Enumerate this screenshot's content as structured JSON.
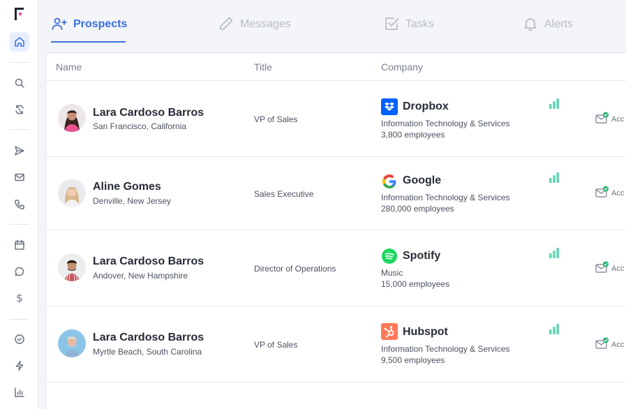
{
  "tabs": [
    {
      "label": "Prospects",
      "active": true
    },
    {
      "label": "Messages",
      "active": false
    },
    {
      "label": "Tasks",
      "active": false
    },
    {
      "label": "Alerts",
      "active": false
    }
  ],
  "columns": {
    "name": "Name",
    "title": "Title",
    "company": "Company"
  },
  "prospects": [
    {
      "name": "Lara Cardoso Barros",
      "location": "San Francisco, California",
      "title": "VP of Sales",
      "company": {
        "name": "Dropbox",
        "industry": "Information Technology & Services",
        "employees": "3,800 employees",
        "icon": "dropbox-logo"
      },
      "account_label": "Acc"
    },
    {
      "name": "Aline Gomes",
      "location": "Denville, New Jersey",
      "title": "Sales Executive",
      "company": {
        "name": "Google",
        "industry": "Information Technology & Services",
        "employees": "280,000 employees",
        "icon": "google-logo"
      },
      "account_label": "Acc"
    },
    {
      "name": "Lara Cardoso Barros",
      "location": "Andover, New Hampshire",
      "title": "Director of Operations",
      "company": {
        "name": "Spotify",
        "industry": "Music",
        "employees": "15,000 employees",
        "icon": "spotify-logo"
      },
      "account_label": "Acc"
    },
    {
      "name": "Lara Cardoso Barros",
      "location": "Myrtle Beach, South Carolina",
      "title": "VP of Sales",
      "company": {
        "name": "Hubspot",
        "industry": "Information Technology & Services",
        "employees": "9,500 employees",
        "icon": "hubspot-logo"
      },
      "account_label": "Acc"
    }
  ],
  "colors": {
    "accent": "#3b6fe0",
    "signal": "#5fd4b4",
    "verified": "#22b573",
    "logo_pink": "#e84ba4"
  },
  "sidebar_icons": [
    "home-icon",
    "search-icon",
    "sync-icon",
    "send-icon",
    "mail-icon",
    "phone-icon",
    "calendar-icon",
    "chat-icon",
    "dollar-icon",
    "check-circle-icon",
    "bolt-icon",
    "bar-chart-icon"
  ],
  "sidebar": {
    "dollar_glyph": "$"
  }
}
